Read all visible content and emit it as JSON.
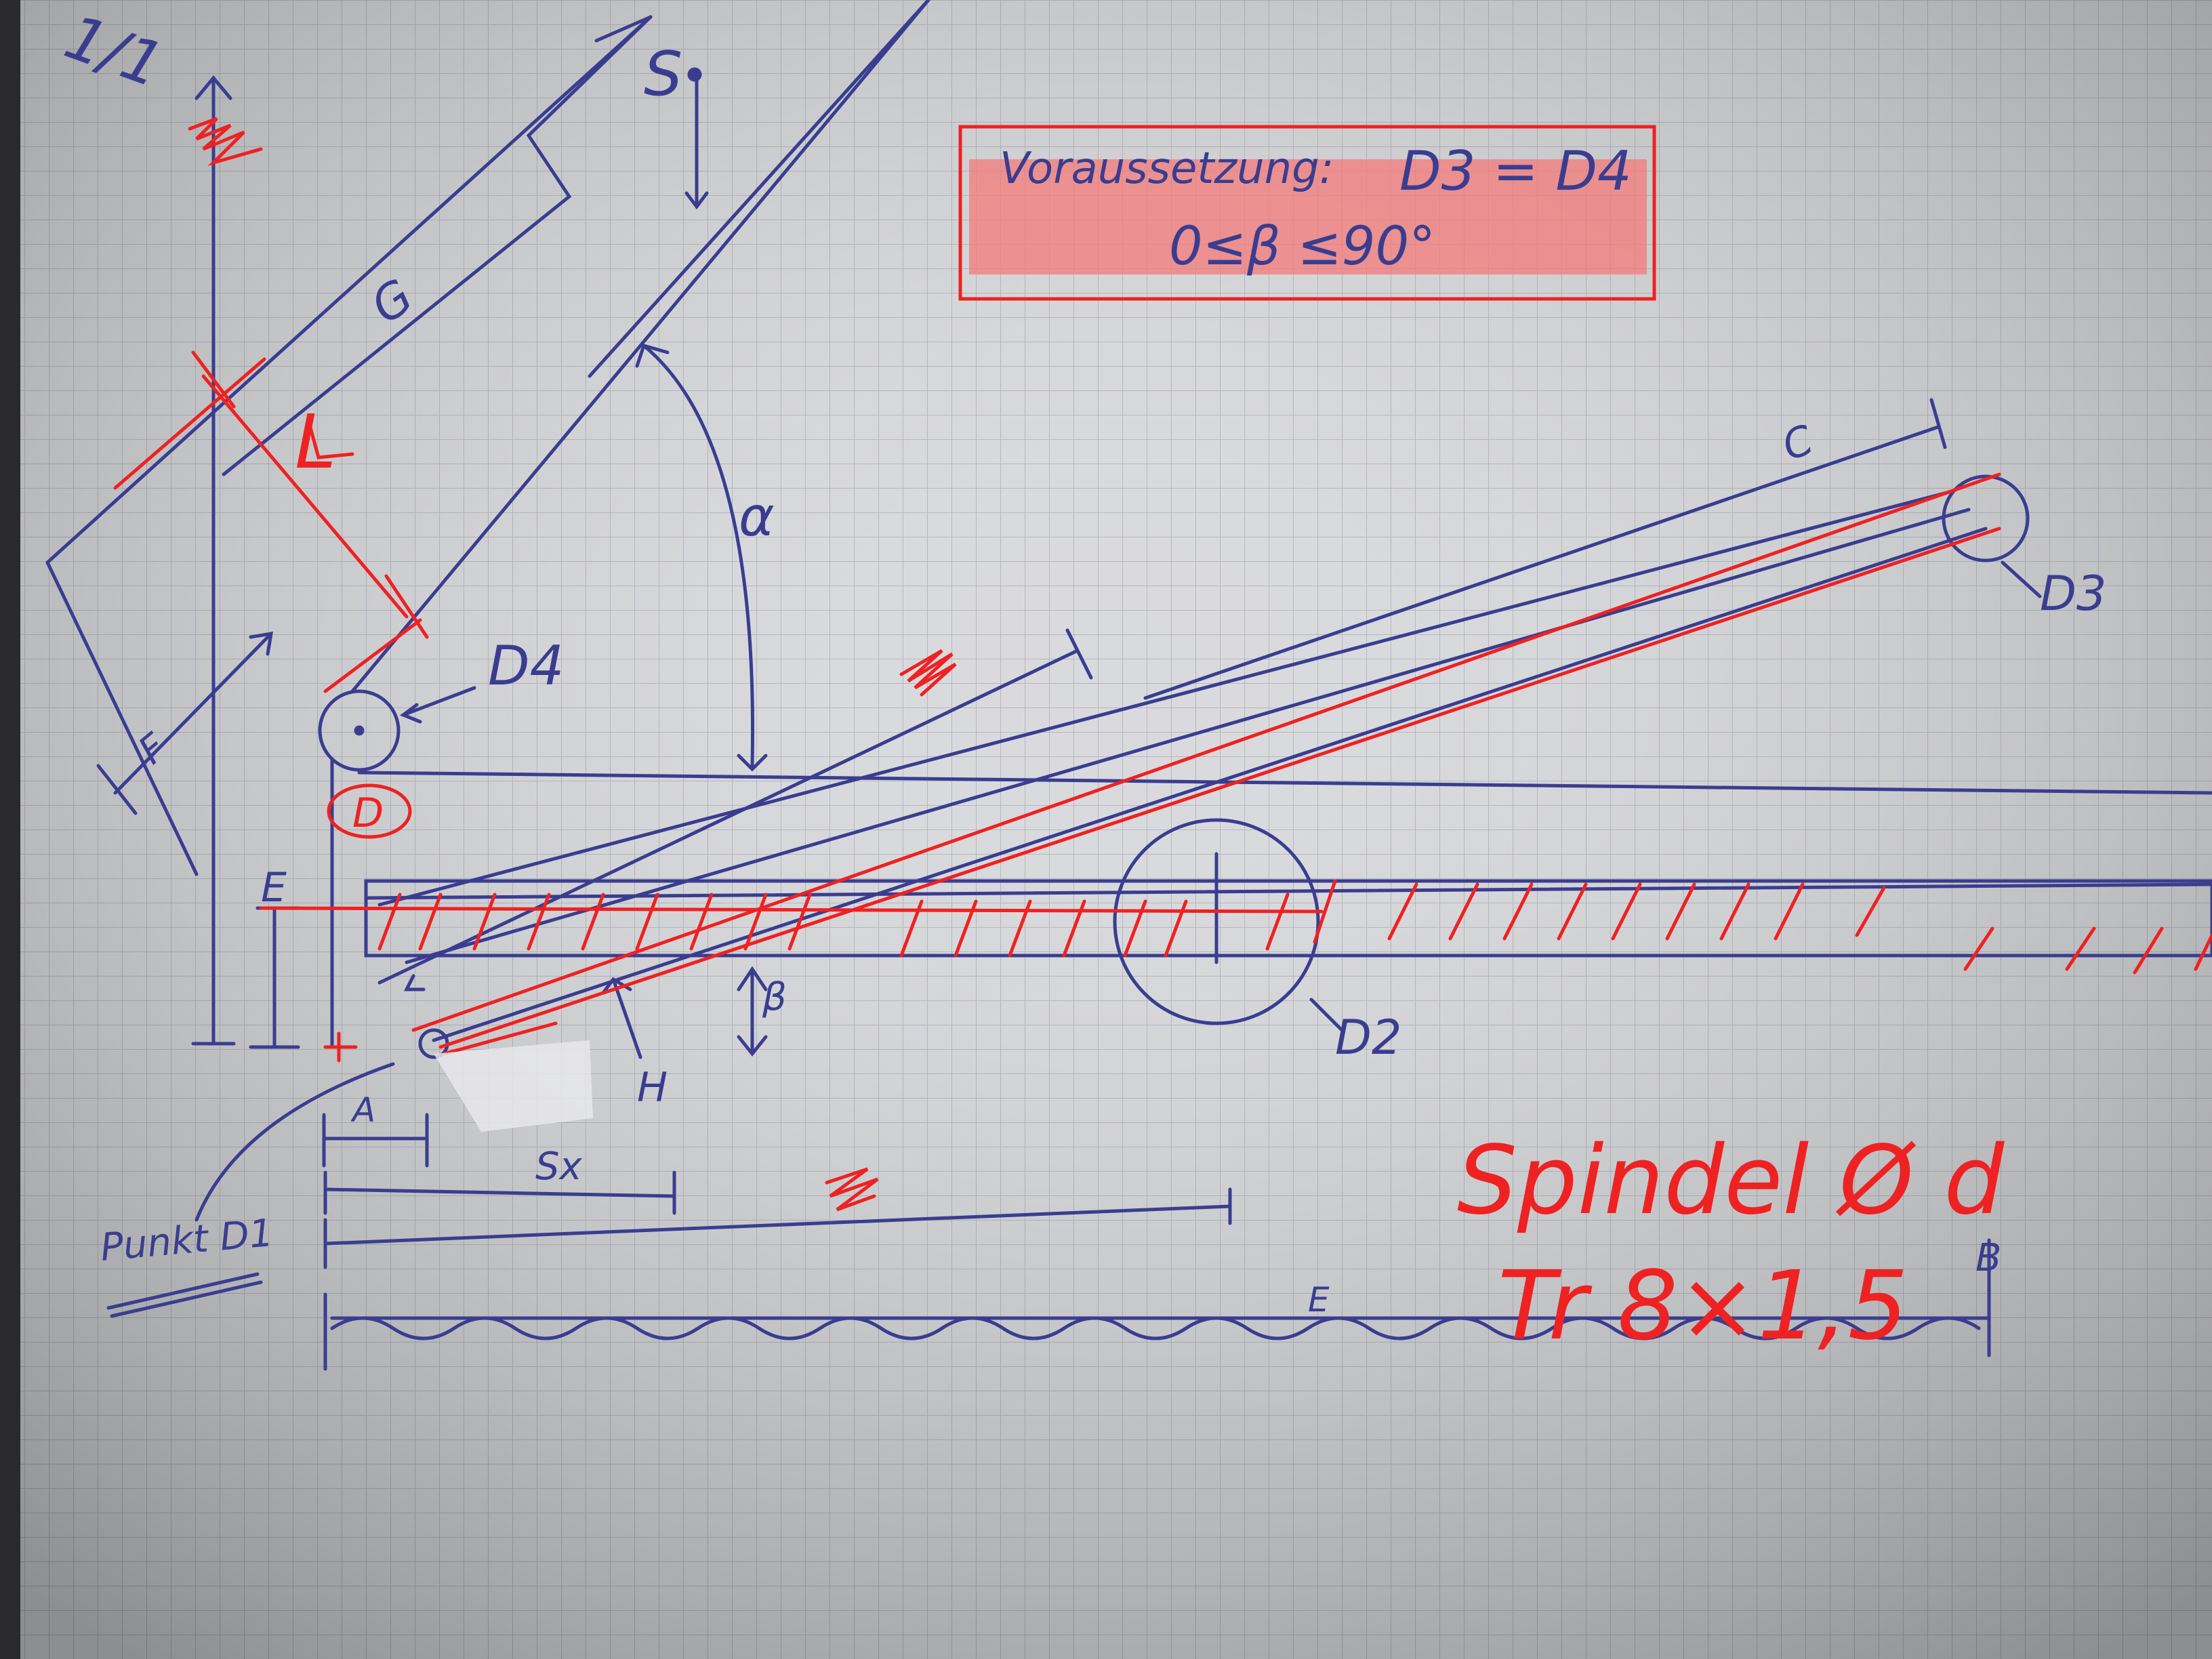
{
  "page_marker": "1/1",
  "labels": {
    "S": "S",
    "G": "G",
    "L": "L",
    "F": "F",
    "alpha": "α",
    "C": "C",
    "D3": "D3",
    "D4": "D4",
    "D": "D",
    "E_top": "E",
    "H": "H",
    "beta": "β",
    "D2": "D2",
    "A": "A",
    "Sx": "Sx",
    "B": "B",
    "E_bottom": "E"
  },
  "condition_box": {
    "line1_label": "Voraussetzung:",
    "line1_formula": "D3 = D4",
    "line2": "0≤β ≤90°"
  },
  "point_label": "Punkt D1",
  "spindle_note": {
    "line1": "Spindel Ø d",
    "line2": "Tr 8×1,5"
  },
  "colors": {
    "paper": "#d9dadd",
    "grid": "#b3b6bd",
    "pen_blue": "#3a3d8f",
    "pen_red": "#ee2222",
    "highlight": "#f47a7a"
  }
}
